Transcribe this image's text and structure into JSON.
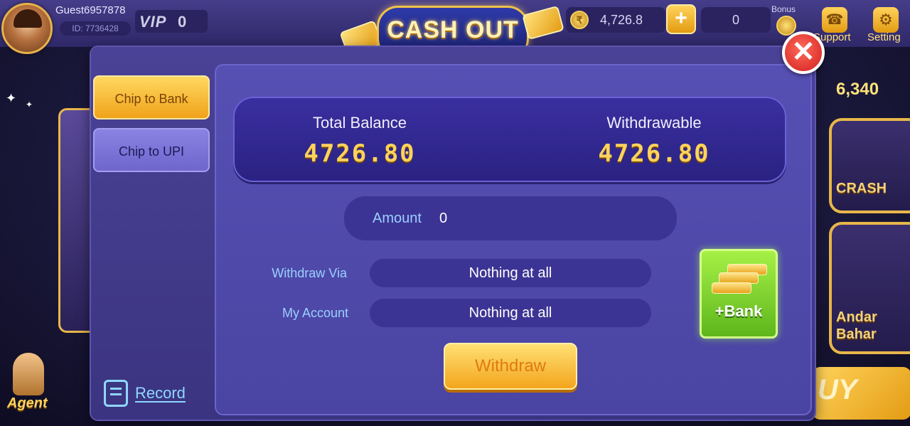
{
  "header": {
    "guest_name": "Guest6957878",
    "guest_id": "ID: 7736428",
    "vip_label": "VIP",
    "vip_level": "0",
    "title": "CASH OUT",
    "coin_balance": "4,726.8",
    "add_coin_symbol": "+",
    "bonus_value": "0",
    "bonus_label": "Bonus",
    "support_label": "Support",
    "setting_label": "Setting"
  },
  "background": {
    "right_counter": "6,340",
    "games": [
      "CRASH",
      "Andar Bahar"
    ],
    "buy_label": "UY",
    "agent_label": "Agent"
  },
  "modal": {
    "tabs": [
      {
        "label": "Chip to Bank",
        "active": true
      },
      {
        "label": "Chip to UPI",
        "active": false
      }
    ],
    "record_label": "Record",
    "balance": {
      "total_title": "Total Balance",
      "total_value": "4726.80",
      "withdrawable_title": "Withdrawable",
      "withdrawable_value": "4726.80"
    },
    "amount": {
      "label": "Amount",
      "value": "0"
    },
    "withdraw_via": {
      "label": "Withdraw Via",
      "value": "Nothing at all"
    },
    "my_account": {
      "label": "My Account",
      "value": "Nothing at all"
    },
    "add_bank_label": "+Bank",
    "withdraw_label": "Withdraw",
    "close_symbol": "✕"
  },
  "colors": {
    "accent_gold": "#ffd35c",
    "panel_purple": "#4a44a2",
    "link_blue": "#9bd0ff",
    "add_bank_green": "#5db61c",
    "close_red": "#d11e1e"
  },
  "icons": [
    "avatar",
    "coin-icon",
    "plus-icon",
    "bonus-coin-icon",
    "support-icon",
    "setting-icon",
    "record-icon",
    "bank-cards-icon",
    "close-icon"
  ]
}
